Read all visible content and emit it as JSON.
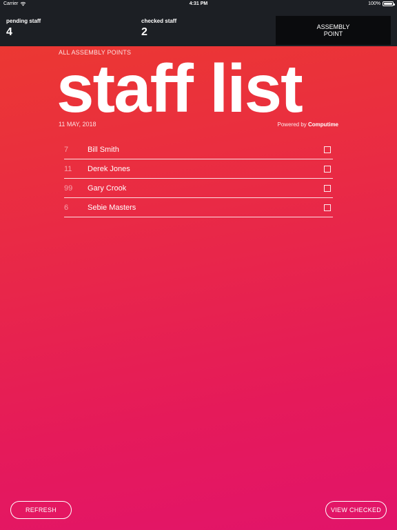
{
  "status_bar": {
    "carrier": "Carrier",
    "time": "4:31 PM",
    "battery": "100%"
  },
  "header": {
    "pending_label": "pending staff",
    "pending_count": "4",
    "checked_label": "checked staff",
    "checked_count": "2",
    "assembly_button": "ASSEMBLY\nPOINT"
  },
  "page": {
    "breadcrumb": "ALL ASSEMBLY POINTS",
    "title": "staff list",
    "date": "11 MAY, 2018",
    "powered_prefix": "Powered by",
    "powered_brand": "Computime"
  },
  "staff": [
    {
      "number": "7",
      "name": "Bill Smith",
      "checked": false
    },
    {
      "number": "11",
      "name": "Derek Jones",
      "checked": false
    },
    {
      "number": "99",
      "name": "Gary Crook",
      "checked": false
    },
    {
      "number": "6",
      "name": "Sebie Masters",
      "checked": false
    }
  ],
  "actions": {
    "refresh": "REFRESH",
    "view_checked": "VIEW CHECKED"
  },
  "colors": {
    "bar": "#1c1f24",
    "assembly_button": "#0a0b0d",
    "gradient_top": "#ec3b2e",
    "gradient_bottom": "#e2146a"
  }
}
